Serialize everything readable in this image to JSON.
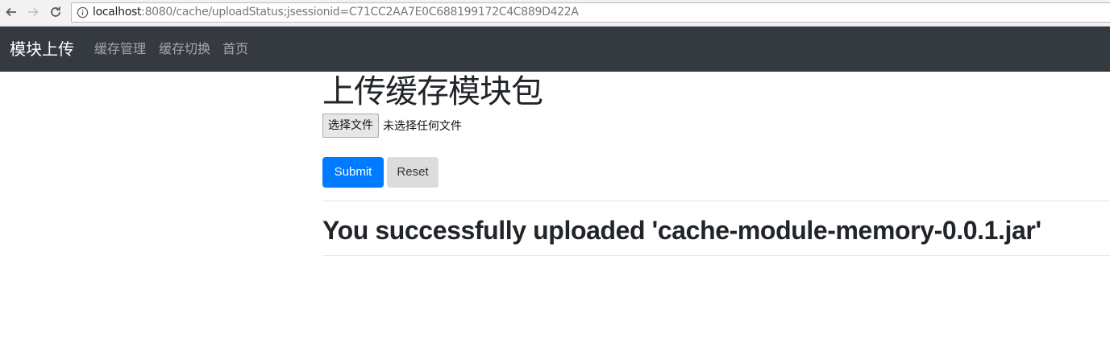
{
  "browser": {
    "url_host": "localhost",
    "url_path": ":8080/cache/uploadStatus;jsessionid=C71CC2AA7E0C688199172C4C889D422A",
    "icons": [
      "back-arrow-icon",
      "forward-arrow-icon",
      "reload-icon",
      "info-icon"
    ]
  },
  "navbar": {
    "brand": "模块上传",
    "links": [
      "缓存管理",
      "缓存切换",
      "首页"
    ]
  },
  "main": {
    "heading": "上传缓存模块包",
    "file_button_label": "选择文件",
    "file_status": "未选择任何文件",
    "submit_label": "Submit",
    "reset_label": "Reset",
    "message": "You successfully uploaded 'cache-module-memory-0.0.1.jar'"
  },
  "colors": {
    "navbar_bg": "#343a40",
    "submit_bg": "#007bff",
    "reset_bg": "#dcdcdc"
  }
}
